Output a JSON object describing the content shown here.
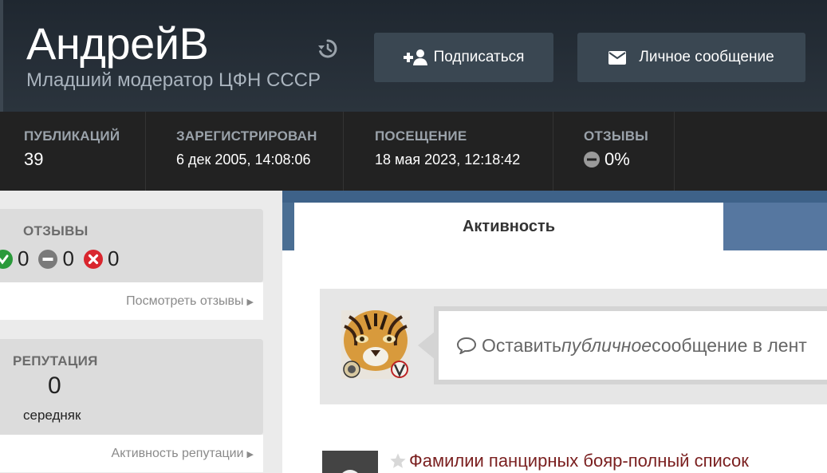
{
  "profile": {
    "name": "АндрейВ",
    "rank": "Младший модератор ЦФН СССР"
  },
  "actions": {
    "follow_label": "Подписаться",
    "message_label": "Личное сообщение"
  },
  "stats": {
    "posts": {
      "label": "ПУБЛИКАЦИЙ",
      "value": "39"
    },
    "joined": {
      "label": "ЗАРЕГИСТРИРОВАН",
      "value": "6 дек 2005, 14:08:06"
    },
    "last_visit": {
      "label": "ПОСЕЩЕНИЕ",
      "value": "18 мая 2023, 12:18:42"
    },
    "feedback": {
      "label": "ОТЗЫВЫ",
      "value": "0%"
    }
  },
  "sidebar": {
    "feedback": {
      "title": "ОТЗЫВЫ",
      "positive": "0",
      "neutral": "0",
      "negative": "0",
      "link": "Посмотреть отзывы"
    },
    "reputation": {
      "title": "РЕПУТАЦИЯ",
      "value": "0",
      "level": "середняк",
      "link": "Активность репутации"
    }
  },
  "tabs": [
    {
      "label": "Активность"
    }
  ],
  "composer": {
    "text_before": "Оставить ",
    "text_emphasis": "публичное",
    "text_after": " сообщение в лент"
  },
  "feed": [
    {
      "title": "Фамилии панцирных бояр-полный список"
    }
  ],
  "colors": {
    "header_bg": "#242d36",
    "stats_bg": "#222222",
    "button_bg": "#3a4752",
    "tab_bar": "#4a6e93",
    "positive": "#2a9a3a",
    "neutral": "#7a7a7a",
    "negative": "#d9262e",
    "link_title": "#7a1f1f"
  }
}
